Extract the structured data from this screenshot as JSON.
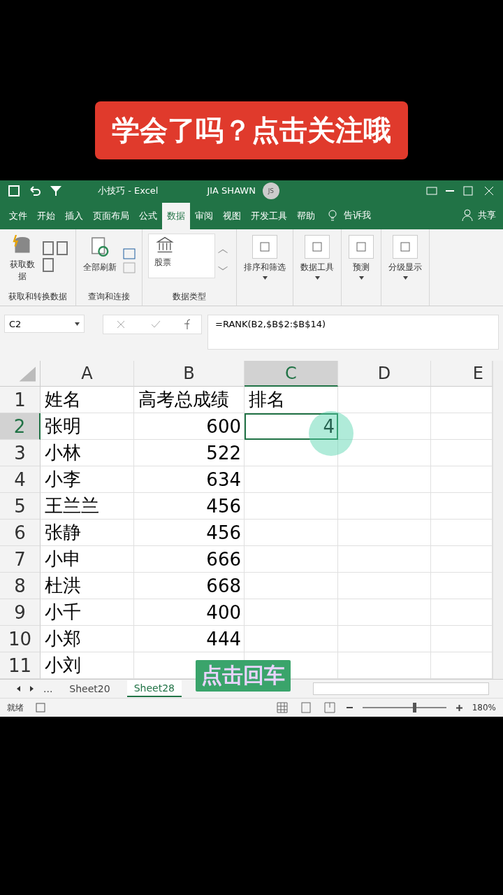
{
  "banner": "学会了吗？点击关注哦",
  "title_bar": {
    "title": "小技巧  -  Excel",
    "user": "JIA SHAWN",
    "avatar": "JS"
  },
  "menu_tabs": [
    {
      "label": "文件",
      "selected": false
    },
    {
      "label": "开始",
      "selected": false
    },
    {
      "label": "插入",
      "selected": false
    },
    {
      "label": "页面布局",
      "selected": false
    },
    {
      "label": "公式",
      "selected": false
    },
    {
      "label": "数据",
      "selected": true
    },
    {
      "label": "审阅",
      "selected": false
    },
    {
      "label": "视图",
      "selected": false
    },
    {
      "label": "开发工具",
      "selected": false
    },
    {
      "label": "帮助",
      "selected": false
    }
  ],
  "tell_me": "告诉我",
  "share": "共享",
  "ribbon": [
    {
      "kind": "get",
      "command": "获取数据",
      "title": "获取和转换数据"
    },
    {
      "kind": "refresh",
      "command": "全部刷新",
      "title": "查询和连接"
    },
    {
      "kind": "types",
      "command": "股票",
      "title": "数据类型"
    },
    {
      "kind": "menu",
      "command": "排序和筛选"
    },
    {
      "kind": "menu",
      "command": "数据工具"
    },
    {
      "kind": "menu",
      "command": "预测"
    },
    {
      "kind": "menu",
      "command": "分级显示"
    }
  ],
  "formula_bar": {
    "name_box": "C2",
    "formula": "=RANK(B2,$B$2:$B$14)"
  },
  "columns": [
    {
      "label": "A",
      "selected": false
    },
    {
      "label": "B",
      "selected": false
    },
    {
      "label": "C",
      "selected": true
    },
    {
      "label": "D",
      "selected": false
    },
    {
      "label": "E",
      "selected": false
    }
  ],
  "rows": [
    {
      "number": "1",
      "selected": false,
      "a": "姓名",
      "b": "高考总成绩",
      "c": "排名",
      "kind": "header"
    },
    {
      "number": "2",
      "selected": true,
      "a": "张明",
      "b": "600",
      "c": "4",
      "kind": "data"
    },
    {
      "number": "3",
      "selected": false,
      "a": "小林",
      "b": "522",
      "kind": "data"
    },
    {
      "number": "4",
      "selected": false,
      "a": "小李",
      "b": "634",
      "kind": "data"
    },
    {
      "number": "5",
      "selected": false,
      "a": "王兰兰",
      "b": "456",
      "kind": "data"
    },
    {
      "number": "6",
      "selected": false,
      "a": "张静",
      "b": "456",
      "kind": "data"
    },
    {
      "number": "7",
      "selected": false,
      "a": "小申",
      "b": "666",
      "kind": "data"
    },
    {
      "number": "8",
      "selected": false,
      "a": "杜洪",
      "b": "668",
      "kind": "data"
    },
    {
      "number": "9",
      "selected": false,
      "a": "小千",
      "b": "400",
      "kind": "data"
    },
    {
      "number": "10",
      "selected": false,
      "a": "小郑",
      "b": "444",
      "kind": "data"
    },
    {
      "number": "11",
      "selected": false,
      "a": "小刘",
      "kind": "data"
    }
  ],
  "sheet_tabs": {
    "more": "...",
    "tabs": [
      {
        "label": "Sheet20",
        "selected": false
      },
      {
        "label": "Sheet28",
        "selected": true
      }
    ]
  },
  "sticker": "点击回车",
  "status_bar": {
    "text": "就绪",
    "zoom": "180%",
    "level": 0.62
  }
}
